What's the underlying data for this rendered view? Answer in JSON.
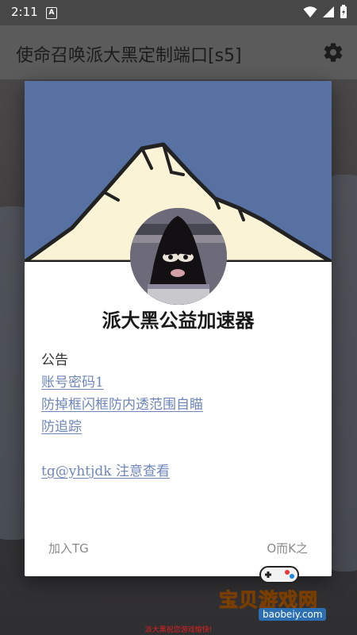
{
  "status_bar": {
    "time": "2:11",
    "notification_letter": "A"
  },
  "app_bar": {
    "title": "使命召唤派大黑定制端口[s5]",
    "settings_icon": "gear-icon"
  },
  "background": {
    "caption": "派大黑祝您游戏愉快!"
  },
  "dialog": {
    "title": "派大黑公益加速器",
    "notice_heading": "公告",
    "links": [
      "账号密码1",
      "防掉框闪框防内透范围自瞄",
      "防追踪"
    ],
    "contact_link": "tg@yhtjdk 注意查看",
    "left_button": "加入TG",
    "right_button": "O而K之"
  },
  "watermark": {
    "title": "宝贝游戏网",
    "url": "baobeiy.com"
  },
  "colors": {
    "header_blue": "#5771a3",
    "link_blue": "#6f86b8",
    "caption_red": "#e02020"
  }
}
